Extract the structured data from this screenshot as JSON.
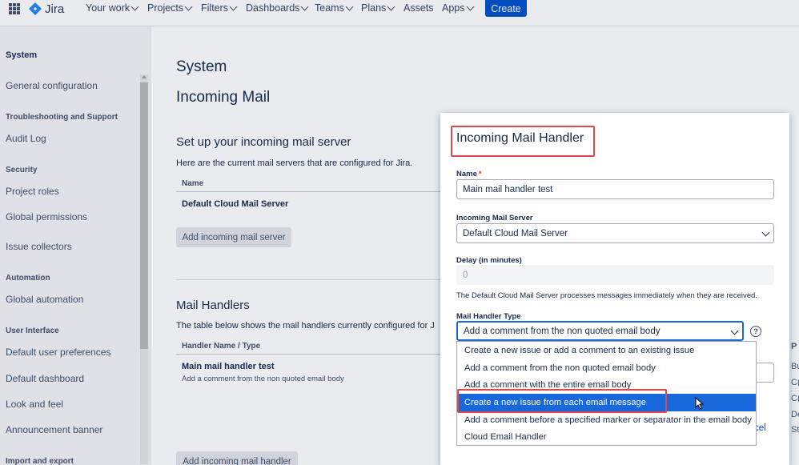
{
  "topnav": {
    "logo_text": "Jira",
    "items": [
      "Your work",
      "Projects",
      "Filters",
      "Dashboards",
      "Teams",
      "Plans",
      "Assets",
      "Apps"
    ],
    "create_label": "Create"
  },
  "sidebar": {
    "title": "System",
    "items": [
      {
        "label": "General configuration",
        "type": "link"
      },
      {
        "label": "Troubleshooting and Support",
        "type": "heading"
      },
      {
        "label": "Audit Log",
        "type": "link"
      },
      {
        "label": "Security",
        "type": "heading"
      },
      {
        "label": "Project roles",
        "type": "link"
      },
      {
        "label": "Global permissions",
        "type": "link"
      },
      {
        "label": "Issue collectors",
        "type": "link"
      },
      {
        "label": "Automation",
        "type": "heading"
      },
      {
        "label": "Global automation",
        "type": "link"
      },
      {
        "label": "User Interface",
        "type": "heading"
      },
      {
        "label": "Default user preferences",
        "type": "link"
      },
      {
        "label": "Default dashboard",
        "type": "link"
      },
      {
        "label": "Look and feel",
        "type": "link"
      },
      {
        "label": "Announcement banner",
        "type": "link"
      },
      {
        "label": "Import and export",
        "type": "heading"
      }
    ]
  },
  "main": {
    "breadcrumb": "System",
    "page_title": "Incoming Mail",
    "mail_server": {
      "heading": "Set up your incoming mail server",
      "description": "Here are the current mail servers that are configured for Jira.",
      "column_name": "Name",
      "server_name": "Default Cloud Mail Server",
      "add_button": "Add incoming mail server"
    },
    "mail_handlers": {
      "heading": "Mail Handlers",
      "description": "The table below shows the mail handlers currently configured for J",
      "column_name": "Handler Name / Type",
      "handler_name": "Main mail handler test",
      "handler_type": "Add a comment from the non quoted email body",
      "add_button": "Add incoming mail handler"
    },
    "right_partial": {
      "col_letter": "P",
      "rows": [
        "Bu",
        "C(",
        "C(",
        "De",
        "St"
      ]
    }
  },
  "modal": {
    "title": "Incoming Mail Handler",
    "name_label": "Name",
    "name_required_mark": "*",
    "name_value": "Main mail handler test",
    "server_label": "Incoming Mail Server",
    "server_value": "Default Cloud Mail Server",
    "delay_label": "Delay (in minutes)",
    "delay_value": "0",
    "note": "The Default Cloud Mail Server processes messages immediately when they are received.",
    "handler_type_label": "Mail Handler Type",
    "handler_type_value": "Add a comment from the non quoted email body",
    "help_glyph": "?",
    "cancel_partial": "cel",
    "options": [
      "Create a new issue or add a comment to an existing issue",
      "Add a comment from the non quoted email body",
      "Add a comment with the entire email body",
      "Create a new issue from each email message",
      "Add a comment before a specified marker or separator in the email body",
      "Cloud Email Handler"
    ],
    "selected_option_index": 3
  },
  "colors": {
    "brand_blue": "#0052cc",
    "selection_blue": "#1868db",
    "highlight_red": "#e0474c"
  }
}
